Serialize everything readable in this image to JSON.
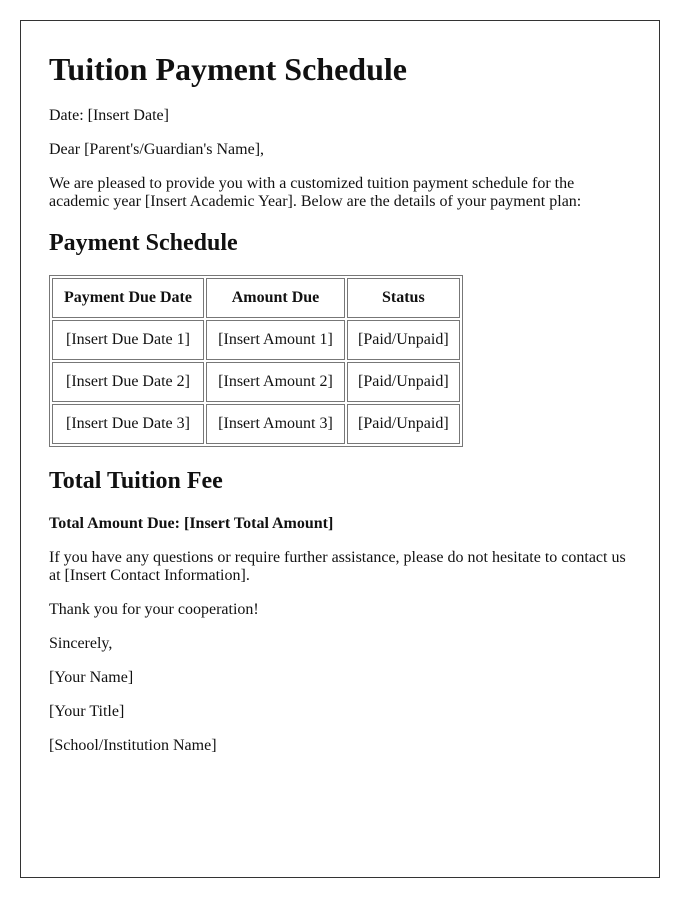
{
  "letter": {
    "title": "Tuition Payment Schedule",
    "date_line": "Date: [Insert Date]",
    "salutation": "Dear [Parent's/Guardian's Name],",
    "intro": "We are pleased to provide you with a customized tuition payment schedule for the academic year [Insert Academic Year]. Below are the details of your payment plan:",
    "schedule_heading": "Payment Schedule",
    "table": {
      "headers": [
        "Payment Due Date",
        "Amount Due",
        "Status"
      ],
      "rows": [
        [
          "[Insert Due Date 1]",
          "[Insert Amount 1]",
          "[Paid/Unpaid]"
        ],
        [
          "[Insert Due Date 2]",
          "[Insert Amount 2]",
          "[Paid/Unpaid]"
        ],
        [
          "[Insert Due Date 3]",
          "[Insert Amount 3]",
          "[Paid/Unpaid]"
        ]
      ]
    },
    "total_heading": "Total Tuition Fee",
    "total_line": "Total Amount Due: [Insert Total Amount]",
    "contact": "If you have any questions or require further assistance, please do not hesitate to contact us at [Insert Contact Information].",
    "thanks": "Thank you for your cooperation!",
    "closing": "Sincerely,",
    "your_name": "[Your Name]",
    "your_title": "[Your Title]",
    "school": "[School/Institution Name]"
  }
}
